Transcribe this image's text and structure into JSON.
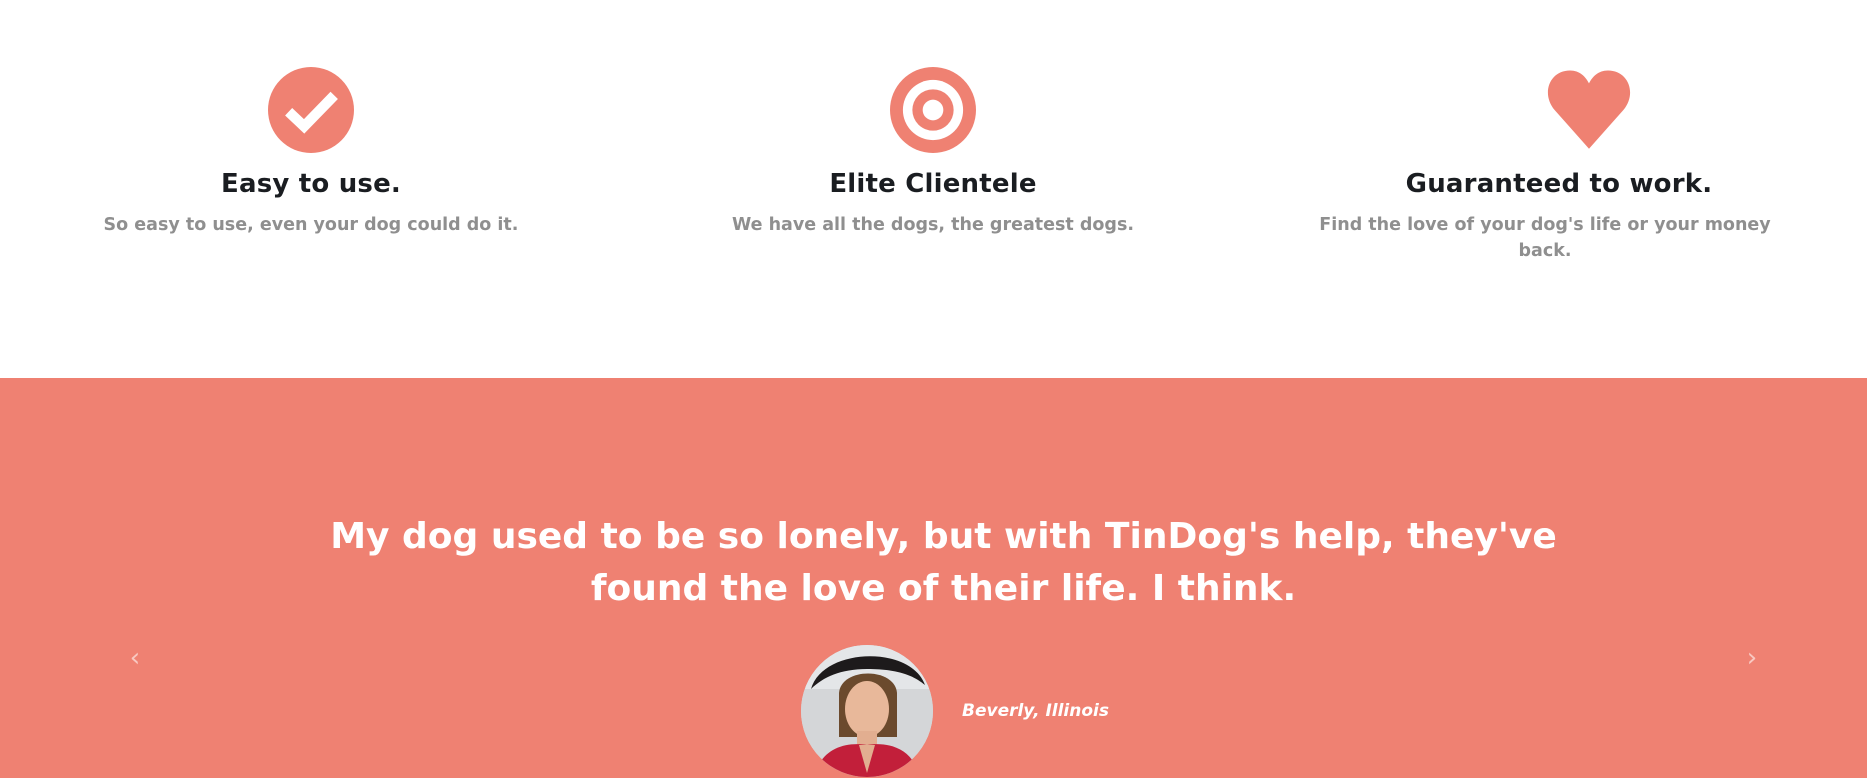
{
  "features": [
    {
      "icon": "check-circle-icon",
      "title": "Easy to use.",
      "description": "So easy to use, even your dog could do it."
    },
    {
      "icon": "bullseye-icon",
      "title": "Elite Clientele",
      "description": "We have all the dogs, the greatest dogs."
    },
    {
      "icon": "heart-icon",
      "title": "Guaranteed to work.",
      "description": "Find the love of your dog's life or your money back."
    }
  ],
  "testimonial": {
    "quote": "My dog used to be so lonely, but with TinDog's help, they've found the love of their life. I think.",
    "author": "Beverly, Illinois",
    "prev_icon": "chevron-left-icon",
    "next_icon": "chevron-right-icon",
    "avatar": "avatar-photo"
  },
  "colors": {
    "accent": "#ef8172",
    "heading": "#1a1d21",
    "muted": "#8f8f8f",
    "white": "#ffffff"
  }
}
